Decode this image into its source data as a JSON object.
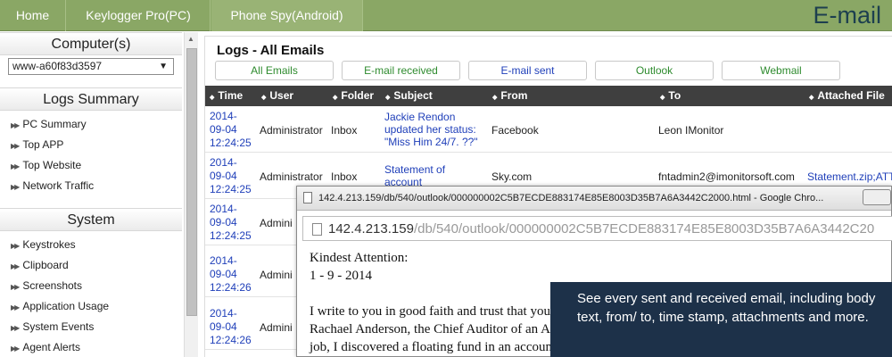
{
  "nav": {
    "tabs": [
      "Home",
      "Keylogger Pro(PC)",
      "Phone Spy(Android)"
    ],
    "page_title": "E-mail"
  },
  "sidebar": {
    "computers_title": "Computer(s)",
    "selected_computer": "www-a60f83d3597",
    "logs_summary_title": "Logs Summary",
    "logs_summary_items": [
      "PC Summary",
      "Top APP",
      "Top Website",
      "Network Traffic"
    ],
    "system_title": "System",
    "system_items": [
      "Keystrokes",
      "Clipboard",
      "Screenshots",
      "Application Usage",
      "System Events",
      "Agent Alerts"
    ]
  },
  "main": {
    "title": "Logs - All Emails",
    "filters": [
      "All Emails",
      "E-mail received",
      "E-mail sent",
      "Outlook",
      "Webmail"
    ],
    "filter_colors": [
      "#2e8b2e",
      "#2e8b2e",
      "#1f3fb9",
      "#2e8b2e",
      "#2e8b2e"
    ],
    "columns": [
      "Time",
      "User",
      "Folder",
      "Subject",
      "From",
      "To",
      "Attached File"
    ],
    "rows": [
      {
        "date": "2014-",
        "date2": "09-04",
        "clock": "12:24:25",
        "user": "Administrator",
        "folder": "Inbox",
        "subject1": "Jackie Rendon",
        "subject2": "updated her status:",
        "subject3": "\"Miss Him 24/7. ??\"",
        "from": "Facebook",
        "to": "Leon IMonitor",
        "attached": ""
      },
      {
        "date": "2014-",
        "date2": "09-04",
        "clock": "12:24:25",
        "user": "Administrator",
        "folder": "Inbox",
        "subject1": "Statement of",
        "subject2": "account",
        "subject3": "",
        "from": "Sky.com",
        "to": "fntadmin2@imonitorsoft.com",
        "attached": "Statement.zip;ATT"
      },
      {
        "date": "2014-",
        "date2": "09-04",
        "clock": "12:24:25",
        "user": "Admini",
        "folder": "",
        "subject1": "",
        "subject2": "",
        "subject3": "",
        "from": "",
        "to": "",
        "attached": ""
      },
      {
        "date": "2014-",
        "date2": "09-04",
        "clock": "12:24:26",
        "user": "Admini",
        "folder": "",
        "subject1": "",
        "subject2": "",
        "subject3": "",
        "from": "",
        "to": "",
        "attached": ""
      },
      {
        "date": "2014-",
        "date2": "09-04",
        "clock": "12:24:26",
        "user": "Admini",
        "folder": "",
        "subject1": "",
        "subject2": "",
        "subject3": "",
        "from": "",
        "to": "",
        "attached": ""
      }
    ]
  },
  "popup": {
    "window_title": "142.4.213.159/db/540/outlook/000000002C5B7ECDE883174E85E8003D35B7A6A3442C2000.html - Google Chro...",
    "url_host": "142.4.213.159",
    "url_path": "/db/540/outlook/000000002C5B7ECDE883174E85E8003D35B7A6A3442C20",
    "body_lines": [
      "Kindest Attention:",
      "1 - 9 - 2014",
      "",
      "I write to you in good faith and trust that you",
      "Rachael Anderson, the Chief Auditor of an A",
      "job, I discovered a floating fund in an account"
    ]
  },
  "info_text": "See every sent and received email, including body text, from/ to, time stamp, attachments and more."
}
